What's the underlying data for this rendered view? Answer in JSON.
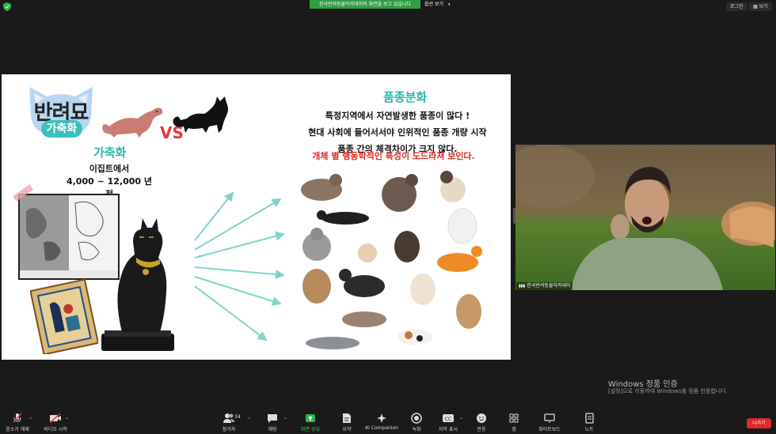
{
  "top_bar": {
    "share_banner": "한국반려동물아카데미의 화면을 보고 있습니다",
    "view_options": "옵션 보기",
    "sign_in": "로그인",
    "view": "보기"
  },
  "slide": {
    "logo_title": "반려묘",
    "logo_pill": "가축화",
    "vs_text": "VS",
    "domestication_heading": "가축화",
    "egypt_line1": "이집트에서",
    "egypt_line2": "4,000 ~ 12,000 년 전",
    "breed_heading": "품종분화",
    "breed_line1": "특정지역에서 자연발생한 품종이 많다 !",
    "breed_line2": "현대 사회에 들어서서야 인위적인 품종 개량 시작",
    "breed_line3": "품종 간의 체격차이가 크지 않다.",
    "breed_red": "개체 별 행동학적인 특성이 도드라져 보인다."
  },
  "camera": {
    "participant_name": "한국반려동물아카데미"
  },
  "windows_watermark": {
    "title": "Windows 정품 인증",
    "subtitle": "[설정]으로 이동하여 Windows를 정품 인증합니다."
  },
  "toolbar": {
    "unmute": "음소거 해제",
    "video": "비디오 시작",
    "participants": "참가자",
    "participants_count": "34",
    "chat": "채팅",
    "share_screen": "화면 공유",
    "summary": "요약",
    "ai_companion": "AI Companion",
    "record": "녹화",
    "captions": "자막 표시",
    "reactions": "반응",
    "apps": "앱",
    "whiteboard": "화이트보드",
    "notes": "노트",
    "leave": "나가기"
  },
  "colors": {
    "share_green": "#2f9e44",
    "teal_accent": "#2bb6b0",
    "red_text": "#e5261f",
    "leave_red": "#e02828"
  }
}
